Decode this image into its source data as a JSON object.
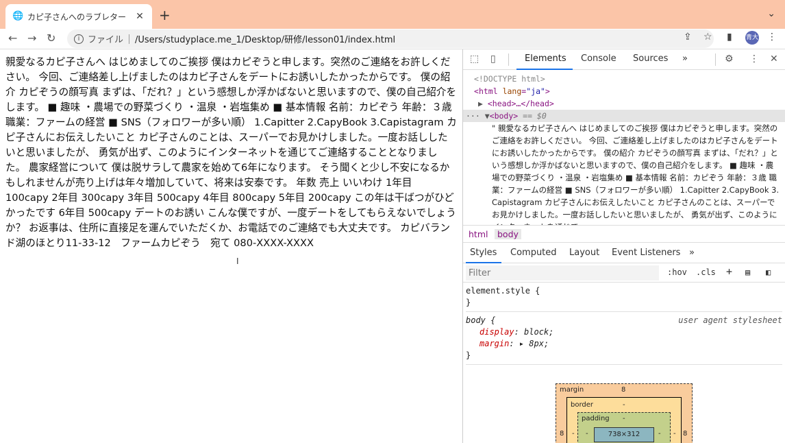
{
  "browser": {
    "tab_title": "カピ子さんへのラブレター",
    "new_tab_label": "+",
    "url_scheme_label": "ファイル",
    "url": "/Users/studyplace.me_1/Desktop/研修/lesson01/index.html",
    "profile_label": "青大"
  },
  "page": {
    "text": "親愛なるカピ子さんへ はじめましてのご挨拶 僕はカピぞうと申します。突然のご連絡をお許しください。 今回、ご連絡差し上げましたのはカピ子さんをデートにお誘いしたかったからです。 僕の紹介 カピぞうの顔写真 まずは、「だれ？」という感想しか浮かばないと思いますので、僕の自己紹介をします。 ■ 趣味 ・農場での野菜づくり ・温泉 ・岩塩集め ■ 基本情報 名前：カピぞう 年齢：３歳 職業：ファームの経営 ■ SNS（フォロワーが多い順） 1.Capitter 2.CapyBook 3.Capistagram カピ子さんにお伝えしたいこと カピ子さんのことは、スーパーでお見かけしました。一度お話ししたいと思いましたが、 勇気が出ず、このようにインターネットを通じてご連絡することとなりました。 農家経営について 僕は脱サラして農家を始めて6年になります。 そう聞くと少し不安になるかもしれませんが売り上げは年々増加していて、将来は安泰です。 年数 売上 いいわけ 1年目 100capy 2年目 300capy 3年目 500capy 4年目 800capy 5年目 200capy この年は干ばつがひどかったです 6年目 500capy デートのお誘い こんな僕ですが、一度デートをしてもらえないでしょうか？ お返事は、住所に直接足を運んでいただくか、お電話でのご連絡でも大丈夫です。 カピバランド湖のほとり11-33-12　ファームカピぞう　宛て 080-XXXX-XXXX"
  },
  "devtools": {
    "tabs": [
      "Elements",
      "Console",
      "Sources"
    ],
    "more_tabs": "»",
    "dom": {
      "doctype": "<!DOCTYPE html>",
      "html_tag": "html",
      "lang_attr": "lang",
      "lang_value": "\"ja\"",
      "head_collapsed": "<head>…</head>",
      "body_tag": "body",
      "body_eq": "== $0",
      "body_text": "\" 親愛なるカピ子さんへ はじめましてのご挨拶 僕はカピぞうと申します。突然のご連絡をお許しください。 今回、ご連絡差し上げましたのはカピ子さんをデートにお誘いしたかったからです。 僕の紹介 カピぞうの顔写真 まずは、「だれ？」という感想しか浮かばないと思いますので、僕の自己紹介をします。 ■ 趣味 ・農場での野菜づくり ・温泉 ・岩塩集め ■ 基本情報 名前：カピぞう 年齢：３歳 職業：ファームの経営 ■ SNS（フォロワーが多い順） 1.Capitter 2.CapyBook 3.Capistagram カピ子さんにお伝えしたいこと カピ子さんのことは、スーパーでお見かけしました。一度お話ししたいと思いましたが、 勇気が出ず、このようにインターネットを通じて"
    },
    "breadcrumbs": [
      "html",
      "body"
    ],
    "styles_tabs": [
      "Styles",
      "Computed",
      "Layout",
      "Event Listeners"
    ],
    "filter_placeholder": "Filter",
    "hov_label": ":hov",
    "cls_label": ".cls",
    "rules": {
      "element_style": "element.style {",
      "close_brace": "}",
      "body_selector": "body {",
      "origin": "user agent stylesheet",
      "display_prop": "display",
      "display_val": "block;",
      "margin_prop": "margin",
      "margin_val": "8px;"
    },
    "box_model": {
      "margin_label": "margin",
      "margin_top": "8",
      "margin_left": "8",
      "margin_right": "8",
      "border_label": "border",
      "border_top": "-",
      "padding_label": "padding",
      "padding_top": "-",
      "side_dash": "-",
      "content_size": "738×312"
    }
  }
}
